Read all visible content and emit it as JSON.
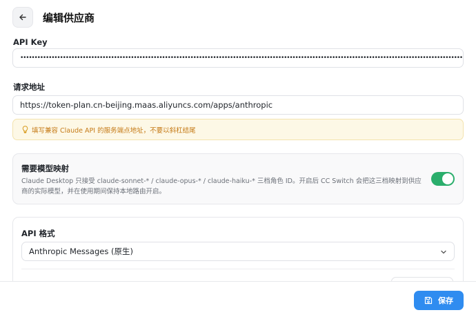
{
  "header": {
    "title": "编辑供应商"
  },
  "api_key": {
    "label": "API Key",
    "value": "•••••••••••••••••••••••••••••••••••••••••••••••••••••••••••••••••••••••••••••••••••••••••••••••••••••••••••••••••••••••••••••••••••••••••••••••••••••••••••••••••••••"
  },
  "endpoint": {
    "label": "请求地址",
    "value": "https://token-plan.cn-beijing.maas.aliyuncs.com/apps/anthropic"
  },
  "hint": {
    "text": "填写兼容 Claude API 的服务端点地址，不要以斜杠结尾"
  },
  "model_mapping": {
    "title": "需要模型映射",
    "description": "Claude Desktop 只接受 claude-sonnet-* / claude-opus-* / claude-haiku-* 三档角色 ID。开启后 CC Switch 会把这三档映射到供应商的实际模型，并在使用期间保持本地路由开启。",
    "enabled": true
  },
  "api_format": {
    "label": "API 格式",
    "selected": "Anthropic Messages (原生)"
  },
  "footer": {
    "save_label": "保存"
  },
  "colors": {
    "accent": "#2f8cf0",
    "toggle_on": "#2bae6c",
    "hint_text": "#c57a16"
  }
}
